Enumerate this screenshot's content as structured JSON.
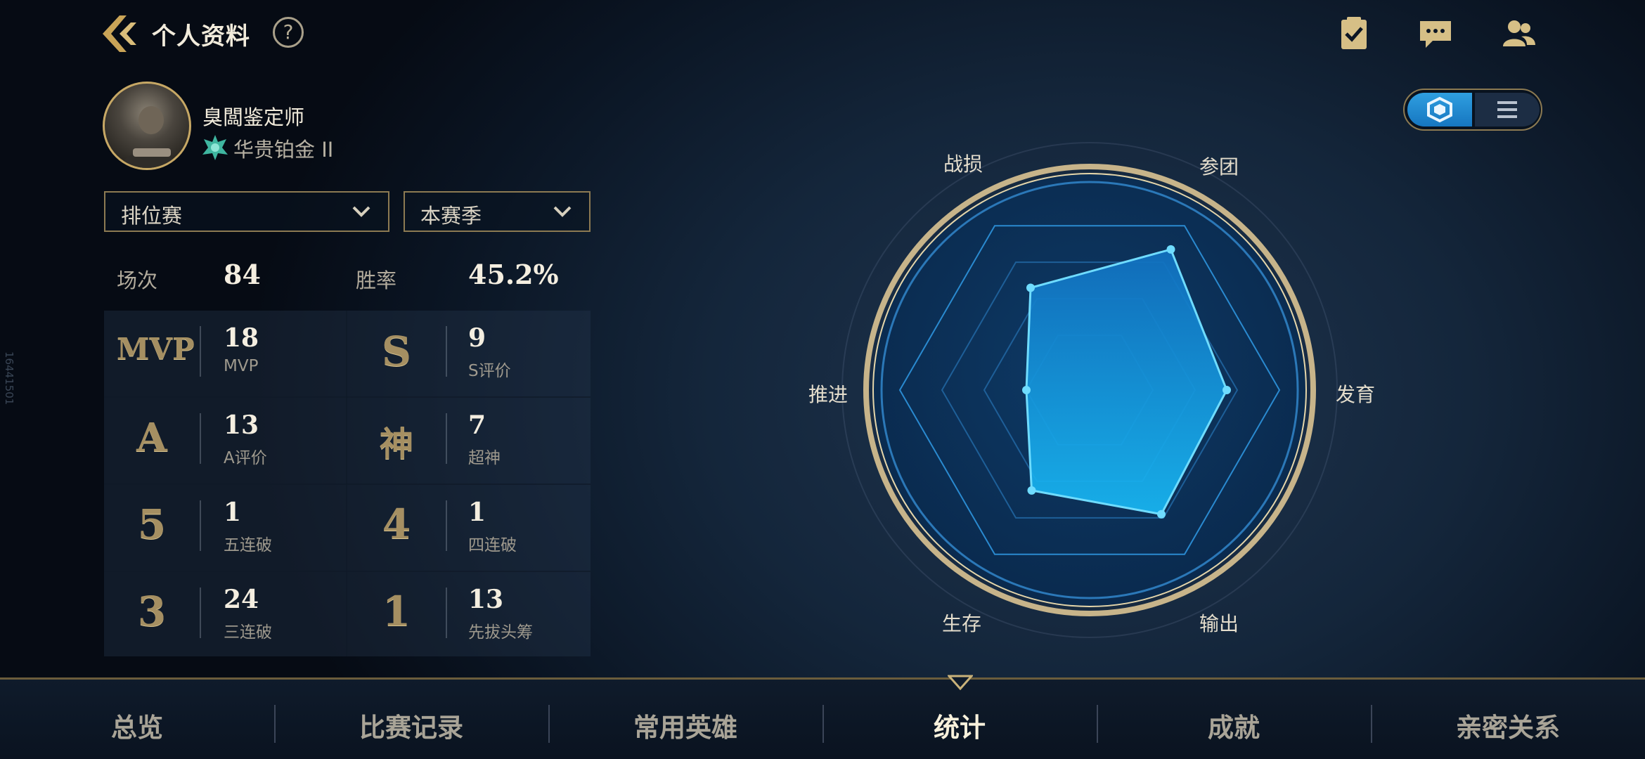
{
  "header": {
    "title": "个人资料",
    "help": "?"
  },
  "profile": {
    "username": "臭闆鉴定师",
    "rank": "华贵铂金 II"
  },
  "filters": {
    "mode": "排位赛",
    "season": "本赛季"
  },
  "summary": {
    "matches_label": "场次",
    "matches_value": "84",
    "winrate_label": "胜率",
    "winrate_value": "45.2%"
  },
  "stats": [
    {
      "badge": "MVP",
      "value": "18",
      "label": "MVP"
    },
    {
      "badge": "S",
      "value": "9",
      "label": "S评价"
    },
    {
      "badge": "A",
      "value": "13",
      "label": "A评价"
    },
    {
      "badge": "神",
      "value": "7",
      "label": "超神"
    },
    {
      "badge": "5",
      "value": "1",
      "label": "五连破"
    },
    {
      "badge": "4",
      "value": "1",
      "label": "四连破"
    },
    {
      "badge": "3",
      "value": "24",
      "label": "三连破"
    },
    {
      "badge": "1",
      "value": "13",
      "label": "先拔头筹"
    }
  ],
  "radar": {
    "axes": [
      "战损",
      "参团",
      "发育",
      "输出",
      "生存",
      "推进"
    ],
    "values": [
      0.56,
      0.77,
      0.65,
      0.68,
      0.55,
      0.3
    ],
    "fill_color": "#16a8f0",
    "stroke_color": "#6fdcff"
  },
  "nav": {
    "items": [
      "总览",
      "比赛记录",
      "常用英雄",
      "统计",
      "成就",
      "亲密关系"
    ],
    "active": "统计"
  },
  "side_id": "16441501"
}
